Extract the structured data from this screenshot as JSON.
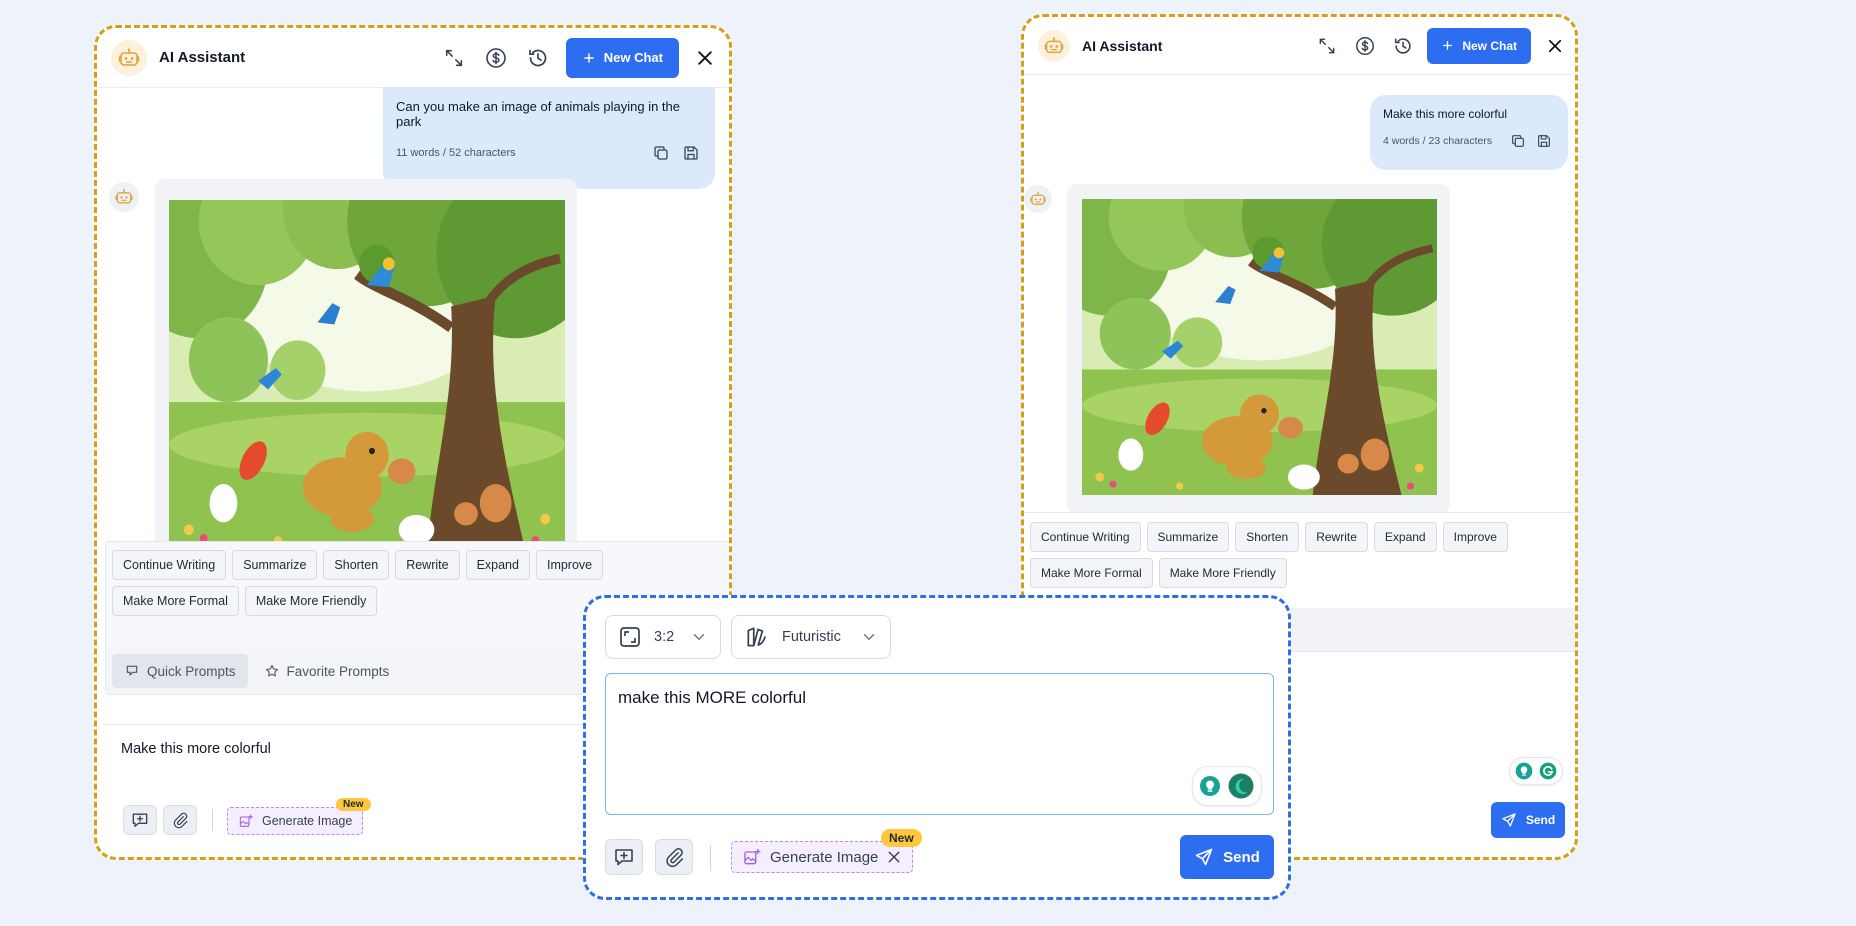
{
  "app_title": "AI Assistant",
  "new_chat_label": "New Chat",
  "left_panel": {
    "user_message": "Can you make an image of animals playing in the park",
    "message_meta": "11 words / 52 characters",
    "quick_actions": [
      "Continue Writing",
      "Summarize",
      "Shorten",
      "Rewrite",
      "Expand",
      "Improve",
      "Make More Formal",
      "Make More Friendly"
    ],
    "tabs": {
      "quick": "Quick Prompts",
      "favorite": "Favorite Prompts"
    },
    "input_value": "Make this more colorful",
    "generate_image_label": "Generate Image",
    "new_badge": "New"
  },
  "right_panel": {
    "user_message": "Make this more colorful",
    "message_meta": "4 words / 23 characters",
    "quick_actions": [
      "Continue Writing",
      "Summarize",
      "Shorten",
      "Rewrite",
      "Expand",
      "Improve",
      "Make More Formal",
      "Make More Friendly"
    ],
    "send_label": "Send"
  },
  "overlay": {
    "aspect_ratio": "3:2",
    "style": "Futuristic",
    "input_value": "make this MORE colorful",
    "generate_image_label": "Generate Image",
    "new_badge": "New",
    "send_label": "Send"
  },
  "colors": {
    "accent": "#2d6ef0",
    "dashed_gold": "#d4a017",
    "dashed_blue": "#2f6fe4",
    "badge": "#ffc73b"
  }
}
